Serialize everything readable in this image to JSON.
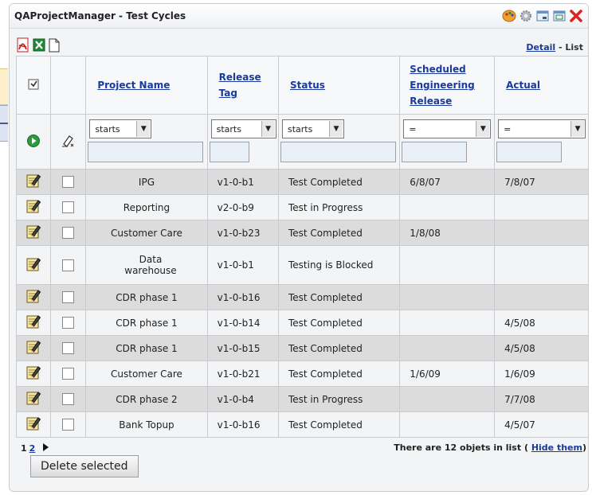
{
  "window": {
    "title": "QAProjectManager - Test Cycles"
  },
  "view_switch": {
    "detail": "Detail",
    "separator": " - ",
    "list": "List"
  },
  "columns": [
    "Project Name",
    "Release Tag",
    "Status",
    "Scheduled Engineering Release",
    "Actual"
  ],
  "filters": {
    "project_name": "starts",
    "release_tag": "starts",
    "status": "starts",
    "scheduled": "=",
    "actual": "="
  },
  "rows": [
    {
      "project": "IPG",
      "tag": "v1-0-b1",
      "status": "Test Completed",
      "scheduled": "6/8/07",
      "actual": "7/8/07"
    },
    {
      "project": "Reporting",
      "tag": "v2-0-b9",
      "status": "Test in Progress",
      "scheduled": "",
      "actual": ""
    },
    {
      "project": "Customer Care",
      "tag": "v1-0-b23",
      "status": "Test Completed",
      "scheduled": "1/8/08",
      "actual": ""
    },
    {
      "project": "Data warehouse",
      "tag": "v1-0-b1",
      "status": "Testing is Blocked",
      "scheduled": "",
      "actual": ""
    },
    {
      "project": "CDR phase 1",
      "tag": "v1-0-b16",
      "status": "Test Completed",
      "scheduled": "",
      "actual": ""
    },
    {
      "project": "CDR phase 1",
      "tag": "v1-0-b14",
      "status": "Test Completed",
      "scheduled": "",
      "actual": "4/5/08"
    },
    {
      "project": "CDR phase 1",
      "tag": "v1-0-b15",
      "status": "Test Completed",
      "scheduled": "",
      "actual": "4/5/08"
    },
    {
      "project": "Customer Care",
      "tag": "v1-0-b21",
      "status": "Test Completed",
      "scheduled": "1/6/09",
      "actual": "1/6/09"
    },
    {
      "project": "CDR phase 2",
      "tag": "v1-0-b4",
      "status": "Test in Progress",
      "scheduled": "",
      "actual": "7/7/08"
    },
    {
      "project": "Bank Topup",
      "tag": "v1-0-b16",
      "status": "Test Completed",
      "scheduled": "",
      "actual": "4/5/07"
    }
  ],
  "pager": {
    "current": "1",
    "next": "2"
  },
  "footer": {
    "count_text": "There are 12 objets in list (",
    "hide_link": "Hide them",
    "close_paren": ")"
  },
  "delete_button": "Delete selected",
  "colors": {
    "accent_link": "#1a3a9c",
    "shaded_row": "#dcdcdc",
    "header_bg": "#f7f8fa"
  }
}
